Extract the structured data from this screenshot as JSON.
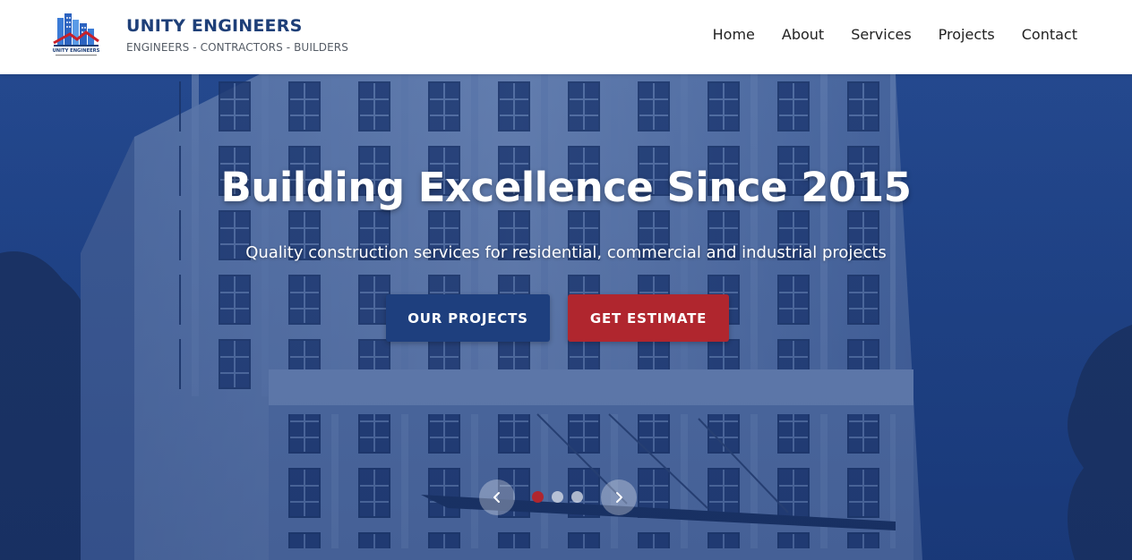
{
  "brand": {
    "name": "UNITY ENGINEERS",
    "tagline": "ENGINEERS - CONTRACTORS - BUILDERS",
    "logo_text": "UNITY ENGINEERS"
  },
  "nav": {
    "items": [
      {
        "label": "Home"
      },
      {
        "label": "About"
      },
      {
        "label": "Services"
      },
      {
        "label": "Projects"
      },
      {
        "label": "Contact"
      }
    ]
  },
  "hero": {
    "title": "Building Excellence Since 2015",
    "subtitle": "Quality construction services for residential, commercial and industrial projects",
    "primary_button": "OUR PROJECTS",
    "secondary_button": "GET ESTIMATE",
    "carousel": {
      "slide_count": 3,
      "active_slide": 1,
      "prev_icon": "chevron-left-icon",
      "next_icon": "chevron-right-icon"
    }
  },
  "colors": {
    "brand_blue": "#1e3f78",
    "primary_button": "#1e3f7e",
    "accent_red": "#b0262e",
    "hero_tint": "#2a4a86"
  }
}
